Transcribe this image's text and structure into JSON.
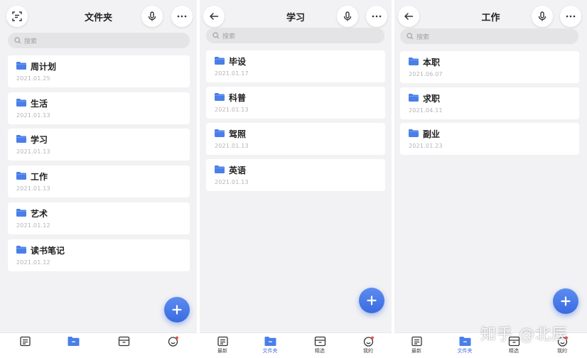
{
  "accent": "#3a6be0",
  "screens": {
    "folders": {
      "title": "文件夹",
      "search_placeholder": "搜索",
      "items": [
        {
          "name": "周计划",
          "date": "2021.01.25"
        },
        {
          "name": "生活",
          "date": "2021.01.13"
        },
        {
          "name": "学习",
          "date": "2021.01.13"
        },
        {
          "name": "工作",
          "date": "2021.01.13"
        },
        {
          "name": "艺术",
          "date": "2021.01.12"
        },
        {
          "name": "读书笔记",
          "date": "2021.01.12"
        }
      ]
    },
    "study": {
      "title": "学习",
      "search_placeholder": "搜索",
      "items": [
        {
          "name": "毕设",
          "date": "2021.01.17"
        },
        {
          "name": "科普",
          "date": "2021.01.13"
        },
        {
          "name": "驾照",
          "date": "2021.01.13"
        },
        {
          "name": "英语",
          "date": "2021.01.13"
        }
      ]
    },
    "work": {
      "title": "工作",
      "search_placeholder": "搜索",
      "items": [
        {
          "name": "本职",
          "date": "2021.06.07"
        },
        {
          "name": "求职",
          "date": "2021.04.11"
        },
        {
          "name": "副业",
          "date": "2021.01.23"
        }
      ]
    }
  },
  "tabbar": {
    "latest": "最新",
    "folders": "文件夹",
    "featured": "精选",
    "mine": "我的"
  },
  "icons": {
    "scan": "scan-icon",
    "back": "back-arrow-icon",
    "mic": "microphone-icon",
    "more": "more-dots-icon",
    "search": "search-icon",
    "folder": "folder-icon",
    "add": "plus-icon"
  },
  "watermark": "知乎 @北辰"
}
